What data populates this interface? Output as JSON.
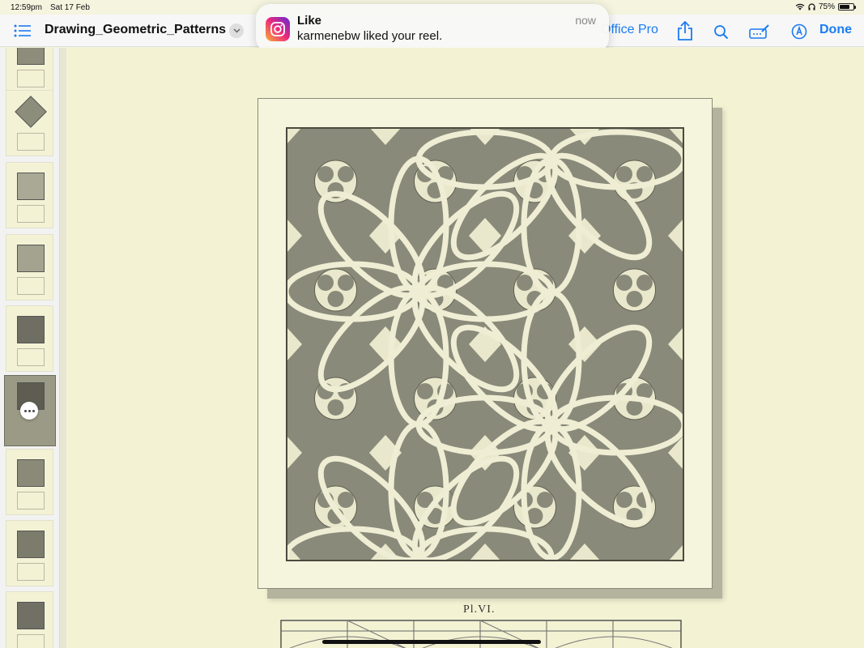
{
  "status_bar": {
    "time": "12:59pm",
    "date": "Sat 17 Feb",
    "battery": "75%",
    "battery_level": 0.75
  },
  "toolbar": {
    "document_title": "Drawing_Geometric_Patterns",
    "office_pro_label": "Office Pro",
    "done_label": "Done"
  },
  "notification": {
    "app": "instagram-icon",
    "title": "Like",
    "body": "karmenebw liked your reel.",
    "time": "now"
  },
  "sidebar": {
    "thumbnail_count": 9,
    "selected_index": 5
  },
  "page": {
    "plate_label": "Pl.VI."
  },
  "colors": {
    "accent": "#1a7cf2",
    "paper": "#f3f2d3",
    "pattern_shadow": "#8d8d7c"
  }
}
